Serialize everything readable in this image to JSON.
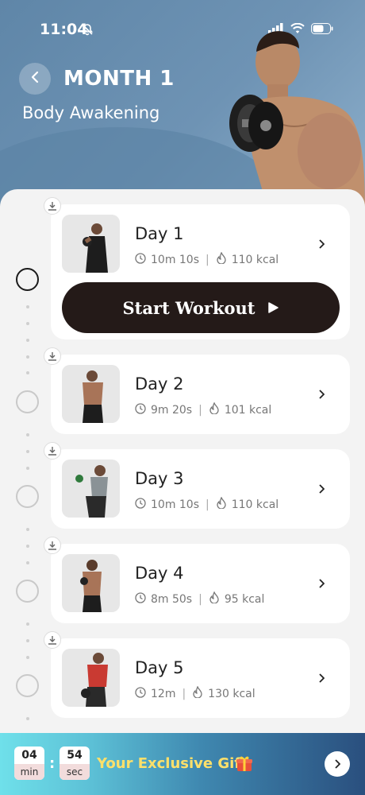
{
  "status_bar": {
    "time": "11:04"
  },
  "header": {
    "title": "MONTH 1",
    "subtitle": "Body Awakening"
  },
  "start_workout": {
    "label": "Start Workout"
  },
  "days": [
    {
      "label": "Day 1",
      "duration": "10m 10s",
      "calories": "110 kcal"
    },
    {
      "label": "Day 2",
      "duration": "9m 20s",
      "calories": "101 kcal"
    },
    {
      "label": "Day 3",
      "duration": "10m 10s",
      "calories": "110 kcal"
    },
    {
      "label": "Day 4",
      "duration": "8m 50s",
      "calories": "95 kcal"
    },
    {
      "label": "Day 5",
      "duration": "12m",
      "calories": "130 kcal"
    }
  ],
  "promo": {
    "minutes": "04",
    "minutes_unit": "min",
    "seconds": "54",
    "seconds_unit": "sec",
    "text": "Your Exclusive Gift"
  },
  "colors": {
    "accent_dark": "#241a18",
    "header_blue": "#6a8fb0",
    "gift_yellow": "#ffe06a"
  }
}
